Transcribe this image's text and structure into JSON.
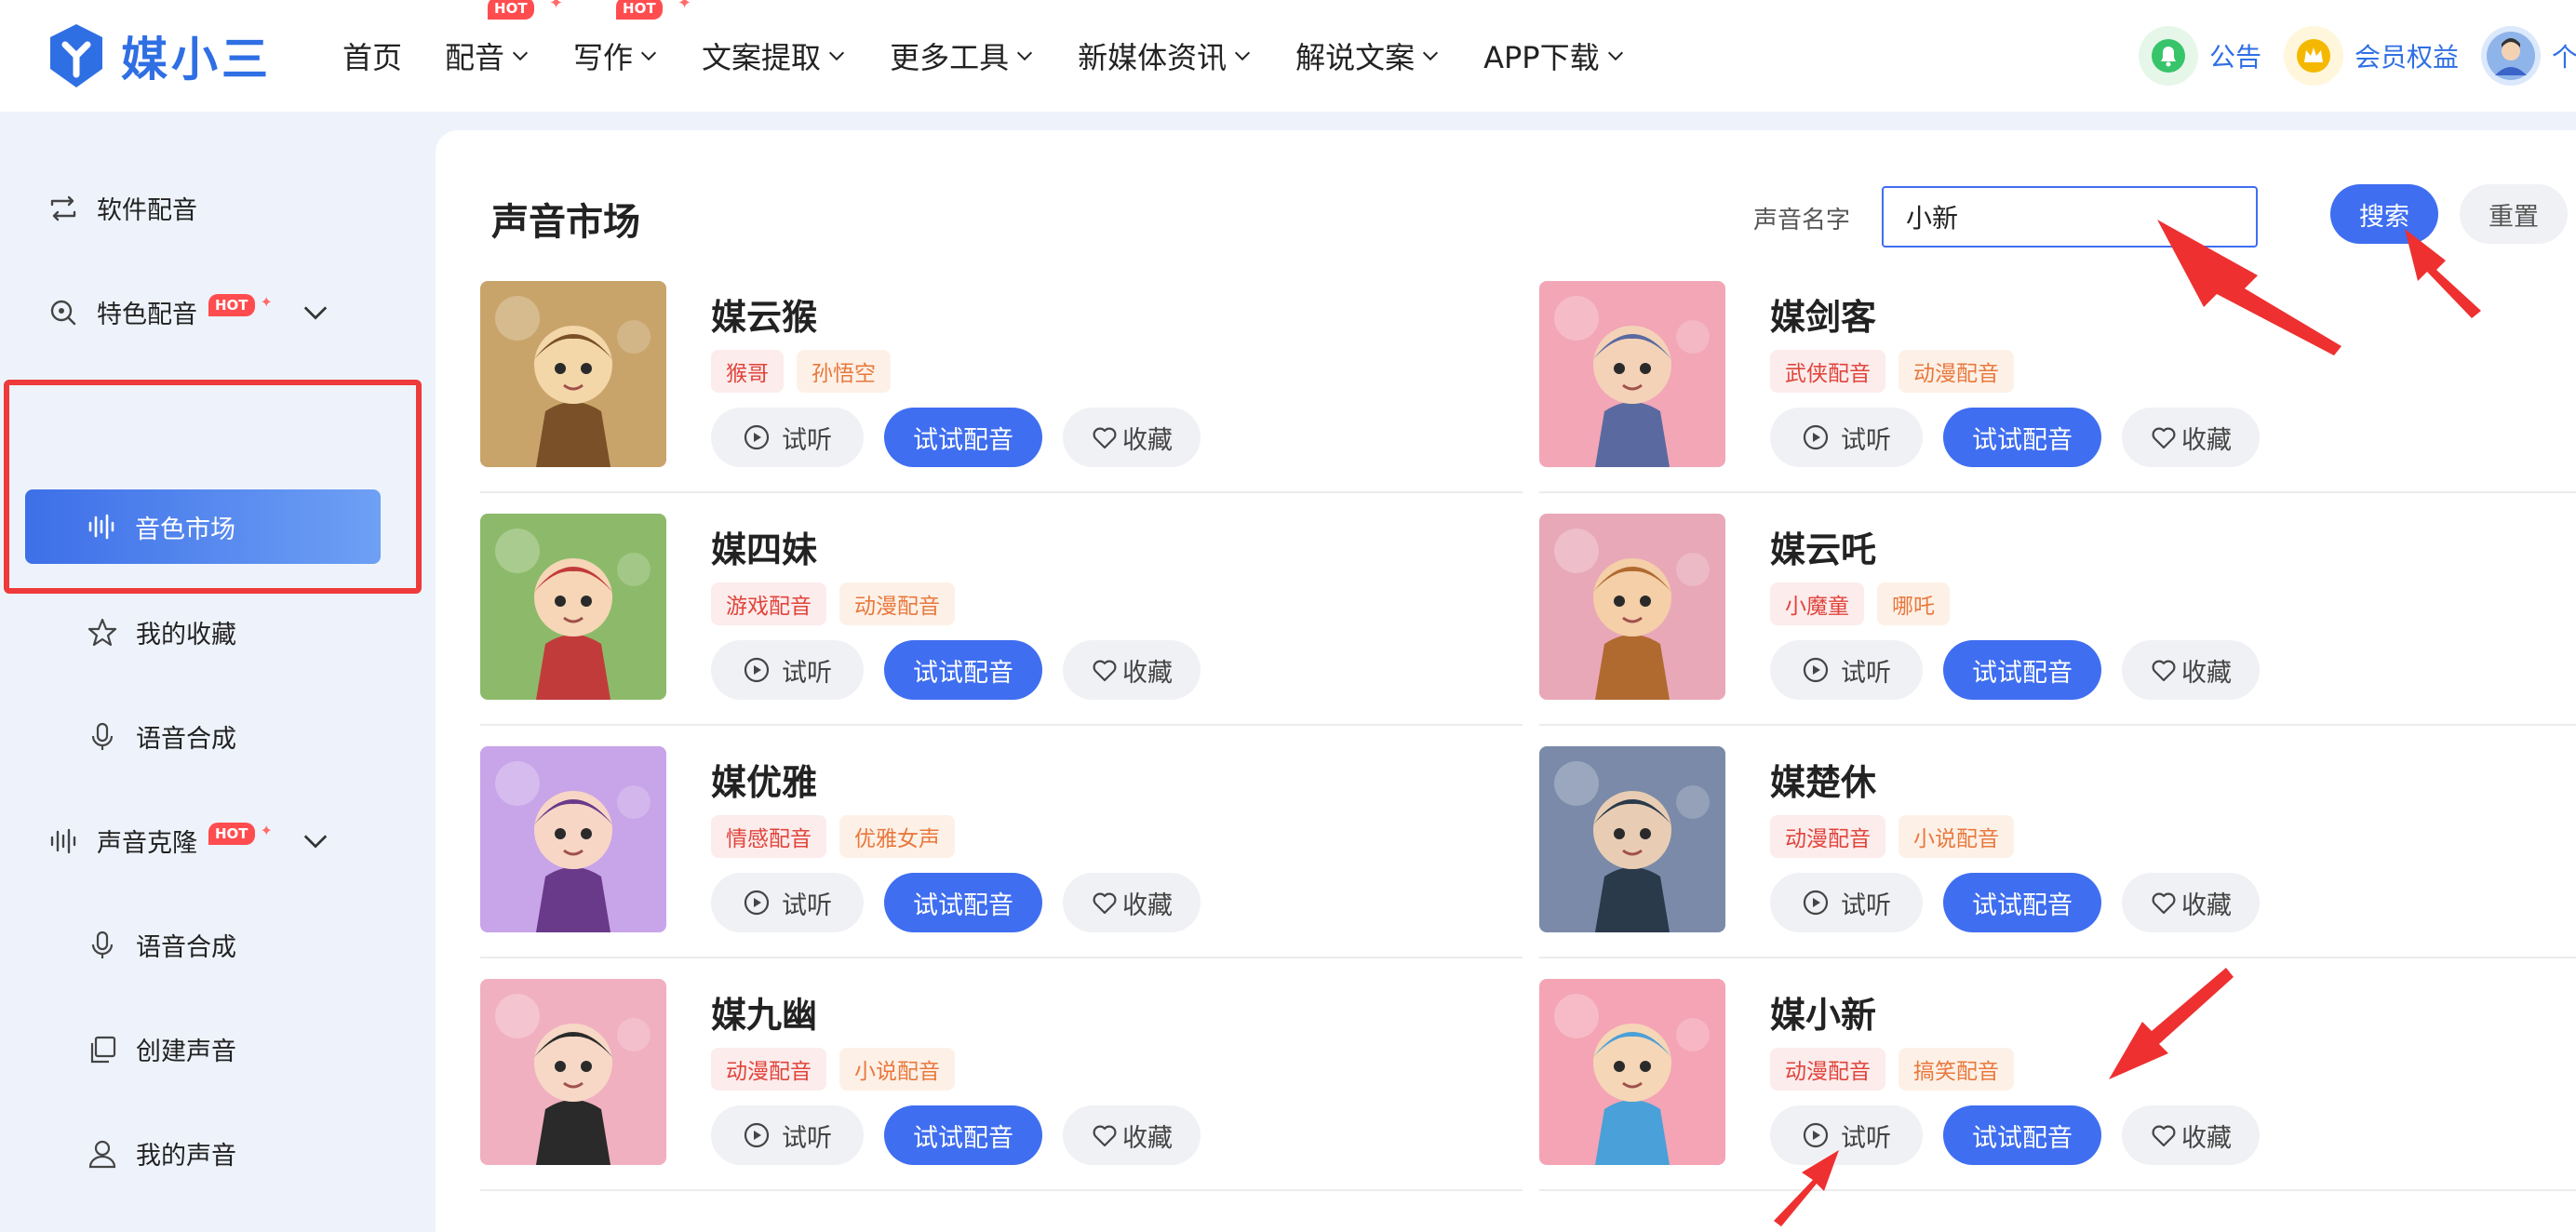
{
  "header": {
    "logo_text": "媒小三",
    "nav": [
      {
        "label": "首页",
        "hot": false,
        "dropdown": false
      },
      {
        "label": "配音",
        "hot": true,
        "dropdown": true
      },
      {
        "label": "写作",
        "hot": true,
        "dropdown": true
      },
      {
        "label": "文案提取",
        "hot": false,
        "dropdown": true
      },
      {
        "label": "更多工具",
        "hot": false,
        "dropdown": true
      },
      {
        "label": "新媒体资讯",
        "hot": false,
        "dropdown": true
      },
      {
        "label": "解说文案",
        "hot": false,
        "dropdown": true
      },
      {
        "label": "APP下载",
        "hot": false,
        "dropdown": true
      }
    ],
    "hot_text": "HOT",
    "announcement": "公告",
    "membership": "会员权益",
    "profile": "个人"
  },
  "sidebar": {
    "software_dubbing": "软件配音",
    "featured_dubbing": "特色配音",
    "voice_market": "音色市场",
    "my_favorites": "我的收藏",
    "tts": "语音合成",
    "voice_clone": "声音克隆",
    "clone_tts": "语音合成",
    "create_voice": "创建声音",
    "my_voice": "我的声音",
    "hot_text": "HOT"
  },
  "main": {
    "title": "声音市场",
    "search_label": "声音名字",
    "search_value": "小新",
    "search_button": "搜索",
    "reset_button": "重置",
    "listen_label": "试听",
    "try_label": "试试配音",
    "fav_label": "收藏",
    "cards": [
      {
        "name": "媒云猴",
        "tags": [
          "猴哥",
          "孙悟空"
        ]
      },
      {
        "name": "媒剑客",
        "tags": [
          "武侠配音",
          "动漫配音"
        ]
      },
      {
        "name": "媒四妹",
        "tags": [
          "游戏配音",
          "动漫配音"
        ]
      },
      {
        "name": "媒云吒",
        "tags": [
          "小魔童",
          "哪吒"
        ]
      },
      {
        "name": "媒优雅",
        "tags": [
          "情感配音",
          "优雅女声"
        ]
      },
      {
        "name": "媒楚休",
        "tags": [
          "动漫配音",
          "小说配音"
        ]
      },
      {
        "name": "媒九幽",
        "tags": [
          "动漫配音",
          "小说配音"
        ]
      },
      {
        "name": "媒小新",
        "tags": [
          "动漫配音",
          "搞笑配音"
        ]
      }
    ]
  },
  "colors": {
    "accent": "#3f6ef0",
    "annotation_red": "#ee3a3a",
    "tag_red": "#e0443b",
    "tag_orange": "#e9783d"
  }
}
